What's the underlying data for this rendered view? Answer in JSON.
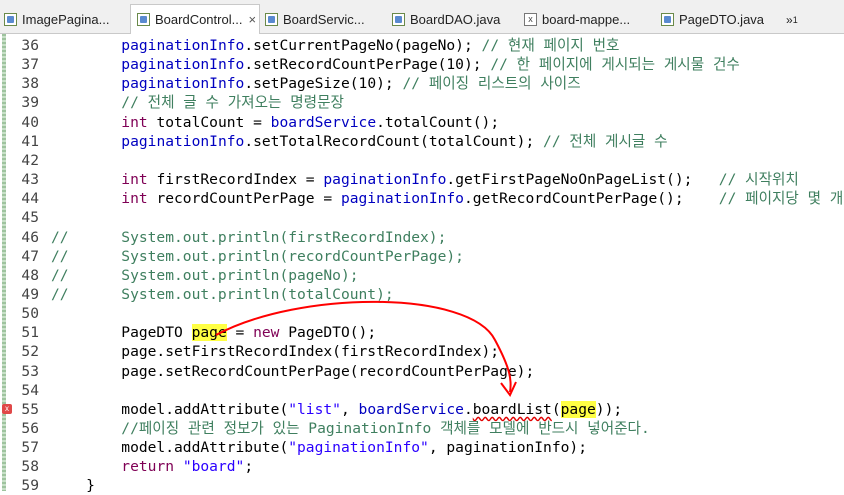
{
  "tabs": [
    {
      "name": "ImagePagina...",
      "type": "java",
      "active": false
    },
    {
      "name": "BoardControl...",
      "type": "java",
      "active": true
    },
    {
      "name": "BoardServic...",
      "type": "java",
      "active": false
    },
    {
      "name": "BoardDAO.java",
      "type": "java",
      "active": false
    },
    {
      "name": "board-mappe...",
      "type": "xml",
      "active": false
    },
    {
      "name": "PageDTO.java",
      "type": "java",
      "active": false
    }
  ],
  "overflow_tabs": {
    "label": "»",
    "count": "1"
  },
  "close_icon": "×",
  "error_marker_line": "55",
  "lines": [
    {
      "n": "36",
      "html": "        <span class=\"fld\">paginationInfo</span>.setCurrentPageNo(pageNo); <span class=\"cm\">// 현재 페이지 번호</span>"
    },
    {
      "n": "37",
      "html": "        <span class=\"fld\">paginationInfo</span>.setRecordCountPerPage(10); <span class=\"cm\">// 한 페이지에 게시되는 게시물 건수</span>"
    },
    {
      "n": "38",
      "html": "        <span class=\"fld\">paginationInfo</span>.setPageSize(10); <span class=\"cm\">// 페이징 리스트의 사이즈</span>"
    },
    {
      "n": "39",
      "html": "        <span class=\"cm\">// 전체 글 수 가져오는 명령문장</span>"
    },
    {
      "n": "40",
      "html": "        <span class=\"kw\">int</span> totalCount = <span class=\"fld\">boardService</span>.totalCount();"
    },
    {
      "n": "41",
      "html": "        <span class=\"fld\">paginationInfo</span>.setTotalRecordCount(totalCount); <span class=\"cm\">// 전체 게시글 수</span>"
    },
    {
      "n": "42",
      "html": ""
    },
    {
      "n": "43",
      "html": "        <span class=\"kw\">int</span> firstRecordIndex = <span class=\"fld\">paginationInfo</span>.getFirstPageNoOnPageList();   <span class=\"cm\">// 시작위치</span>"
    },
    {
      "n": "44",
      "html": "        <span class=\"kw\">int</span> recordCountPerPage = <span class=\"fld\">paginationInfo</span>.getRecordCountPerPage();    <span class=\"cm\">// 페이지당 몇 개?</span>"
    },
    {
      "n": "45",
      "html": ""
    },
    {
      "n": "46",
      "html": "<span class=\"cm\">//      System.out.println(firstRecordIndex);</span>"
    },
    {
      "n": "47",
      "html": "<span class=\"cm\">//      System.out.println(recordCountPerPage);</span>"
    },
    {
      "n": "48",
      "html": "<span class=\"cm\">//      System.out.println(pageNo);</span>"
    },
    {
      "n": "49",
      "html": "<span class=\"cm\">//      System.out.println(totalCount);</span>"
    },
    {
      "n": "50",
      "html": ""
    },
    {
      "n": "51",
      "html": "        PageDTO <span class=\"hl\">page</span> = <span class=\"kw\">new</span> PageDTO();"
    },
    {
      "n": "52",
      "html": "        page.setFirstRecordIndex(firstRecordIndex);"
    },
    {
      "n": "53",
      "html": "        page.setRecordCountPerPage(recordCountPerPage);"
    },
    {
      "n": "54",
      "html": ""
    },
    {
      "n": "55",
      "html": "        model.addAttribute(<span class=\"str\">\"list\"</span>, <span class=\"fld\">boardService</span>.<span class=\"err\">boardList</span>(<span class=\"hl\">page</span>));"
    },
    {
      "n": "56",
      "html": "        <span class=\"cm\">//페이징 관련 정보가 있는 PaginationInfo 객체를 모델에 반드시 넣어준다.</span>"
    },
    {
      "n": "57",
      "html": "        model.addAttribute(<span class=\"str\">\"paginationInfo\"</span>, paginationInfo);"
    },
    {
      "n": "58",
      "html": "        <span class=\"kw\">return</span> <span class=\"str\">\"board\"</span>;"
    },
    {
      "n": "59",
      "html": "    }"
    }
  ]
}
